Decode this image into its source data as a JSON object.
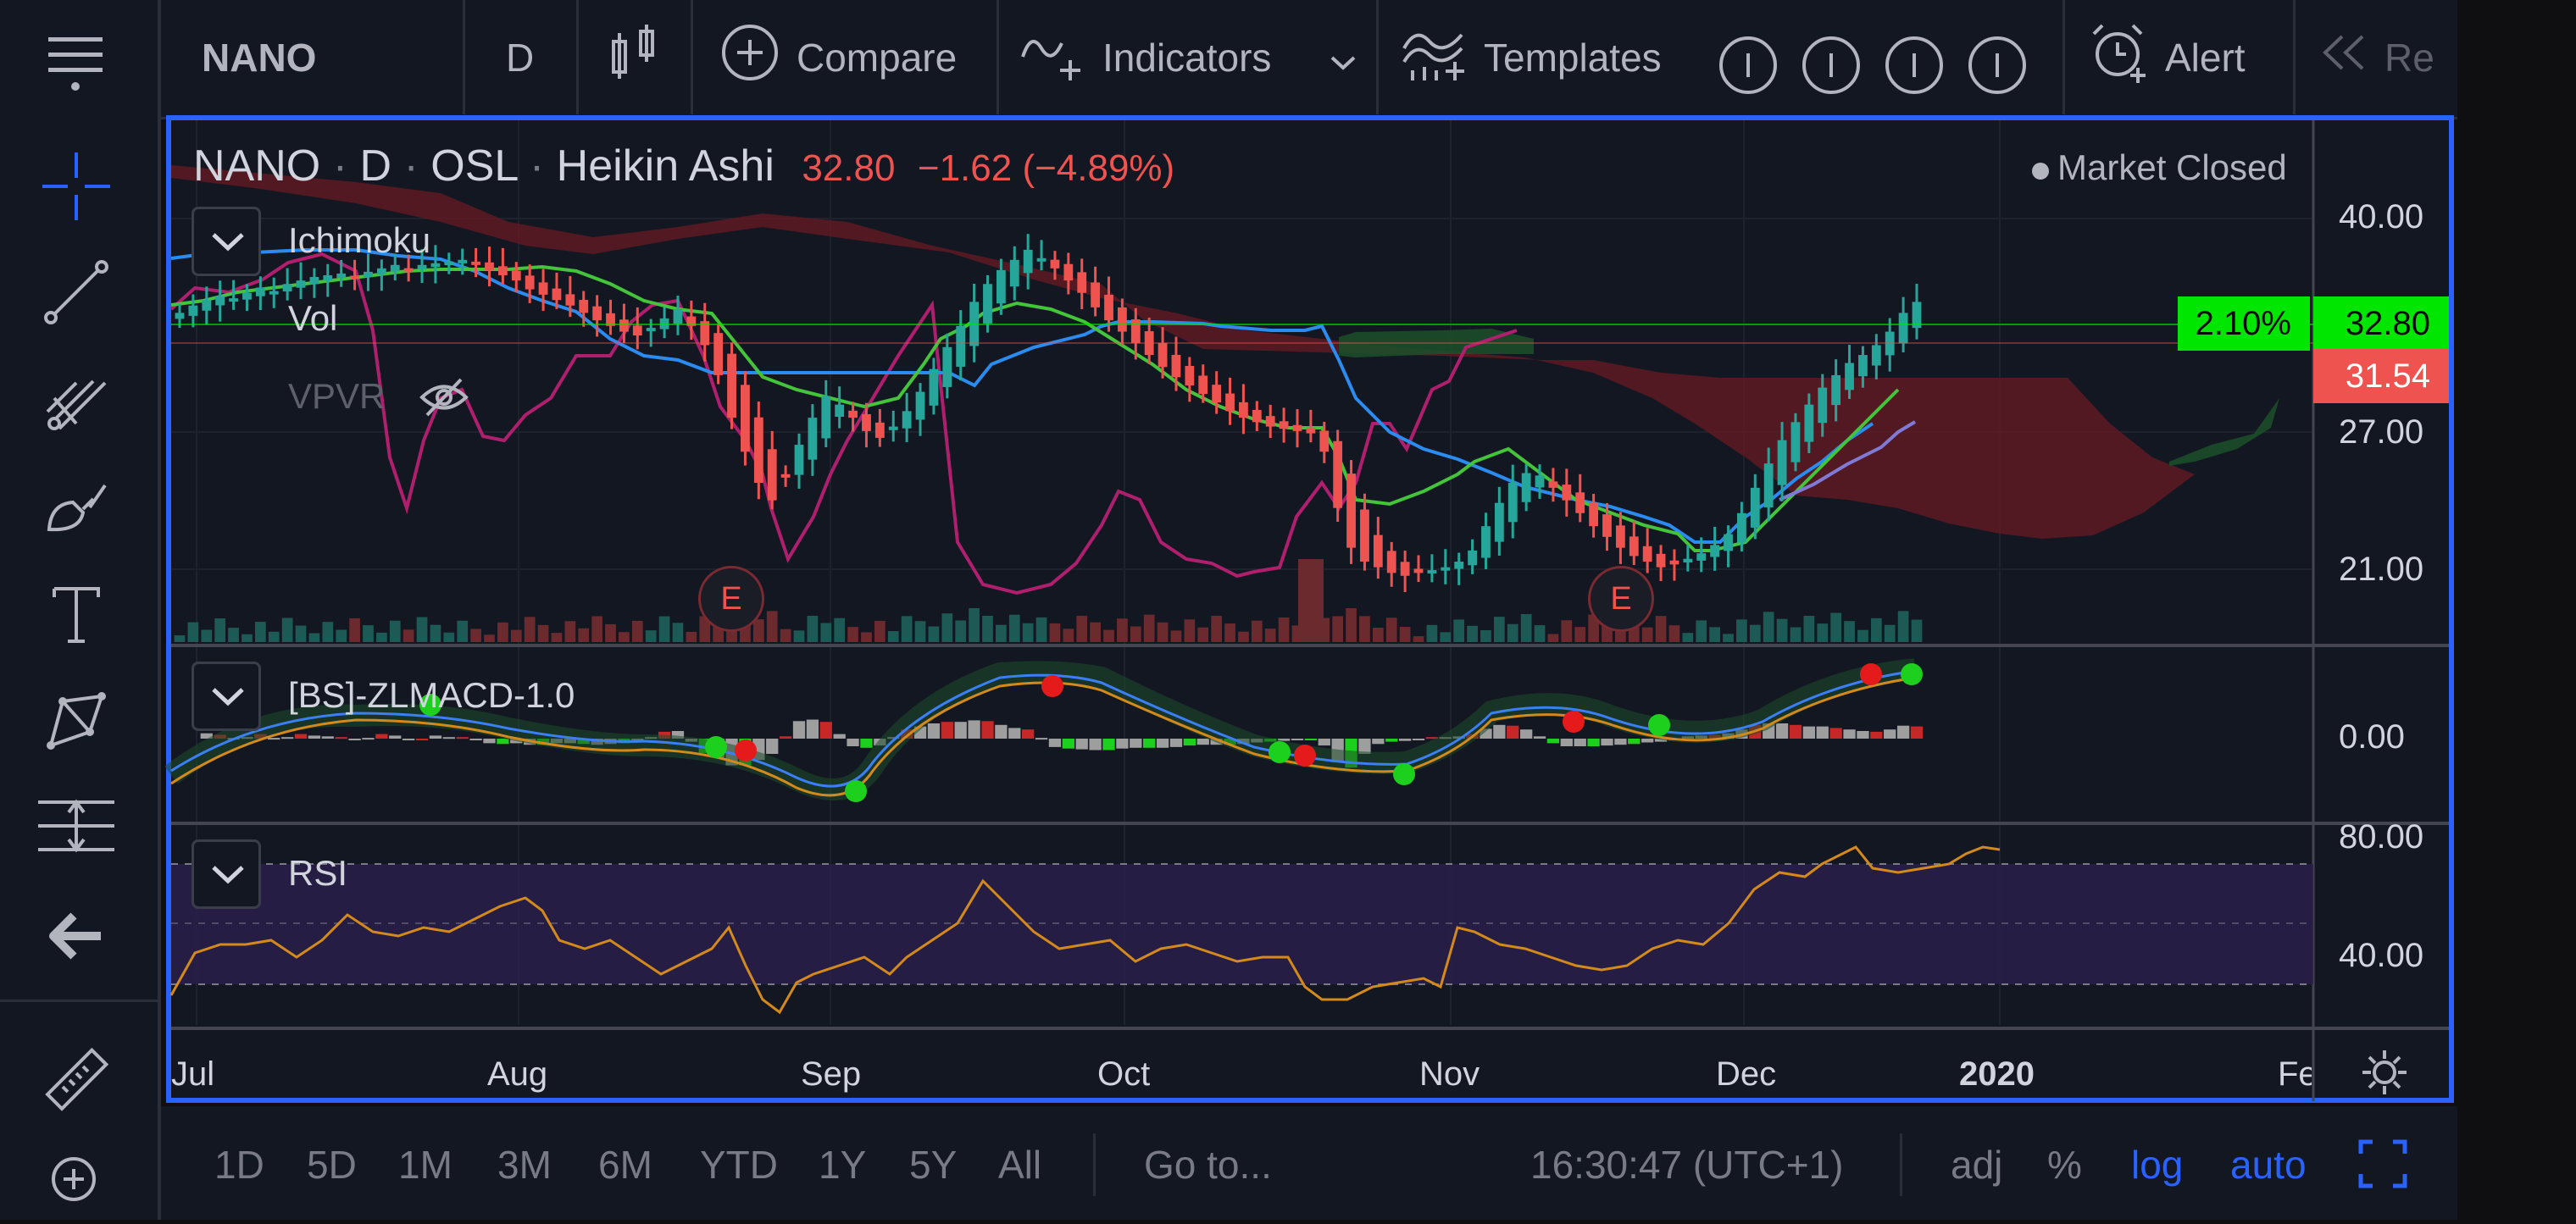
{
  "symbol_bar": {
    "symbol": "NANO",
    "interval": "D"
  },
  "toolbar": {
    "compare": "Compare",
    "indicators": "Indicators",
    "templates": "Templates",
    "alert": "Alert",
    "replay": "Re"
  },
  "legend": {
    "symbol": "NANO",
    "sep1": "·",
    "interval": "D",
    "sep2": "·",
    "exchange": "OSL",
    "sep3": "·",
    "chart_type": "Heikin Ashi",
    "last": "32.80",
    "change": "−1.62 (−4.89%)",
    "market_status": "Market Closed"
  },
  "studies": {
    "ichimoku": "Ichimoku",
    "vol": "Vol",
    "vpvr": "VPVR",
    "zlmacd": "[BS]-ZLMACD-1.0",
    "rsi": "RSI"
  },
  "markers": {
    "earnings1": "E",
    "earnings2": "E"
  },
  "price_scale": {
    "ticks": [
      "40.00",
      "27.00",
      "21.00"
    ],
    "badge_pct": "2.10%",
    "last_price": "32.80",
    "prev_price": "31.54"
  },
  "macd_scale": {
    "zero": "0.00"
  },
  "rsi_scale": {
    "upper": "80.00",
    "mid": "40.00"
  },
  "time_scale": [
    "Jul",
    "Aug",
    "Sep",
    "Oct",
    "Nov",
    "Dec",
    "2020",
    "Fe"
  ],
  "ranges": [
    "1D",
    "5D",
    "1M",
    "3M",
    "6M",
    "YTD",
    "1Y",
    "5Y",
    "All"
  ],
  "goto": "Go to...",
  "clock": "16:30:47 (UTC+1)",
  "toggles": {
    "adj": "adj",
    "pct": "%",
    "log": "log",
    "auto": "auto"
  },
  "colors": {
    "up": "#26a69a",
    "down": "#ef5350",
    "accent": "#2962ff",
    "badge_green": "#00e600",
    "cloud_red": "#5b1a22",
    "cloud_green": "#1d4d2a",
    "rsi_band": "#2a1e4a"
  },
  "chart_data": {
    "type": "candlestick",
    "chart_style": "Heikin Ashi",
    "scale": "log",
    "ylim": [
      19,
      44
    ],
    "x_labels": [
      "Jul",
      "Aug",
      "Sep",
      "Oct",
      "Nov",
      "Dec",
      "2020"
    ],
    "close": [
      32.2,
      32.6,
      32.9,
      33.1,
      33.0,
      33.3,
      33.6,
      33.4,
      33.8,
      34.0,
      34.2,
      34.3,
      34.4,
      34.1,
      34.5,
      34.7,
      34.9,
      34.6,
      34.9,
      35.0,
      35.1,
      35.2,
      35.0,
      34.6,
      34.3,
      34.0,
      33.5,
      33.2,
      32.9,
      32.6,
      32.2,
      31.8,
      31.5,
      31.2,
      31.0,
      31.4,
      31.9,
      32.4,
      31.5,
      30.5,
      29.0,
      27.0,
      25.5,
      24.2,
      23.5,
      24.5,
      25.8,
      27.0,
      28.0,
      27.6,
      27.0,
      26.4,
      26.1,
      26.6,
      27.3,
      28.2,
      29.3,
      30.4,
      31.5,
      32.8,
      33.8,
      34.6,
      35.2,
      35.8,
      35.3,
      34.7,
      34.0,
      33.3,
      32.5,
      31.8,
      31.2,
      30.6,
      30.0,
      29.4,
      28.9,
      28.5,
      28.1,
      27.7,
      27.3,
      27.0,
      26.8,
      26.6,
      26.5,
      26.4,
      26.3,
      25.5,
      23.2,
      21.7,
      21.2,
      21.0,
      20.8,
      20.7,
      20.8,
      20.9,
      21.0,
      21.2,
      21.6,
      22.5,
      23.4,
      24.2,
      24.6,
      24.5,
      24.0,
      23.5,
      23.0,
      22.5,
      22.1,
      21.7,
      21.4,
      21.2,
      21.0,
      21.1,
      21.3,
      21.5,
      21.8,
      22.2,
      23.0,
      24.0,
      25.0,
      26.0,
      26.8,
      27.6,
      28.4,
      29.0,
      29.6,
      30.0,
      30.5,
      31.2,
      32.2,
      32.8
    ]
  }
}
